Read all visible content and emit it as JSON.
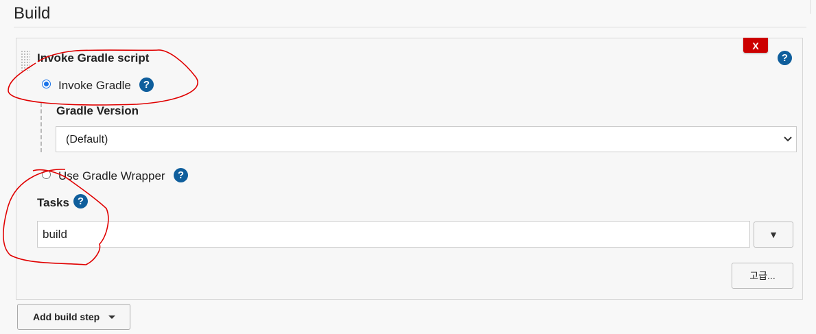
{
  "section": {
    "title": "Build"
  },
  "step": {
    "title": "Invoke Gradle script",
    "delete_label": "X",
    "help_label": "?"
  },
  "options": {
    "invoke_gradle": {
      "label": "Invoke Gradle",
      "checked": true
    },
    "gradle_version": {
      "label": "Gradle Version",
      "selected": "(Default)"
    },
    "use_wrapper": {
      "label": "Use Gradle Wrapper",
      "checked": false
    }
  },
  "tasks": {
    "label": "Tasks",
    "value": "build",
    "dropdown_symbol": "▼"
  },
  "buttons": {
    "advanced": "고급...",
    "add_build_step": "Add build step"
  },
  "colors": {
    "help_icon": "#0f5e9c",
    "delete_button": "#cc0000",
    "radio_checked": "#1a73e8",
    "annotation": "#e00000"
  }
}
